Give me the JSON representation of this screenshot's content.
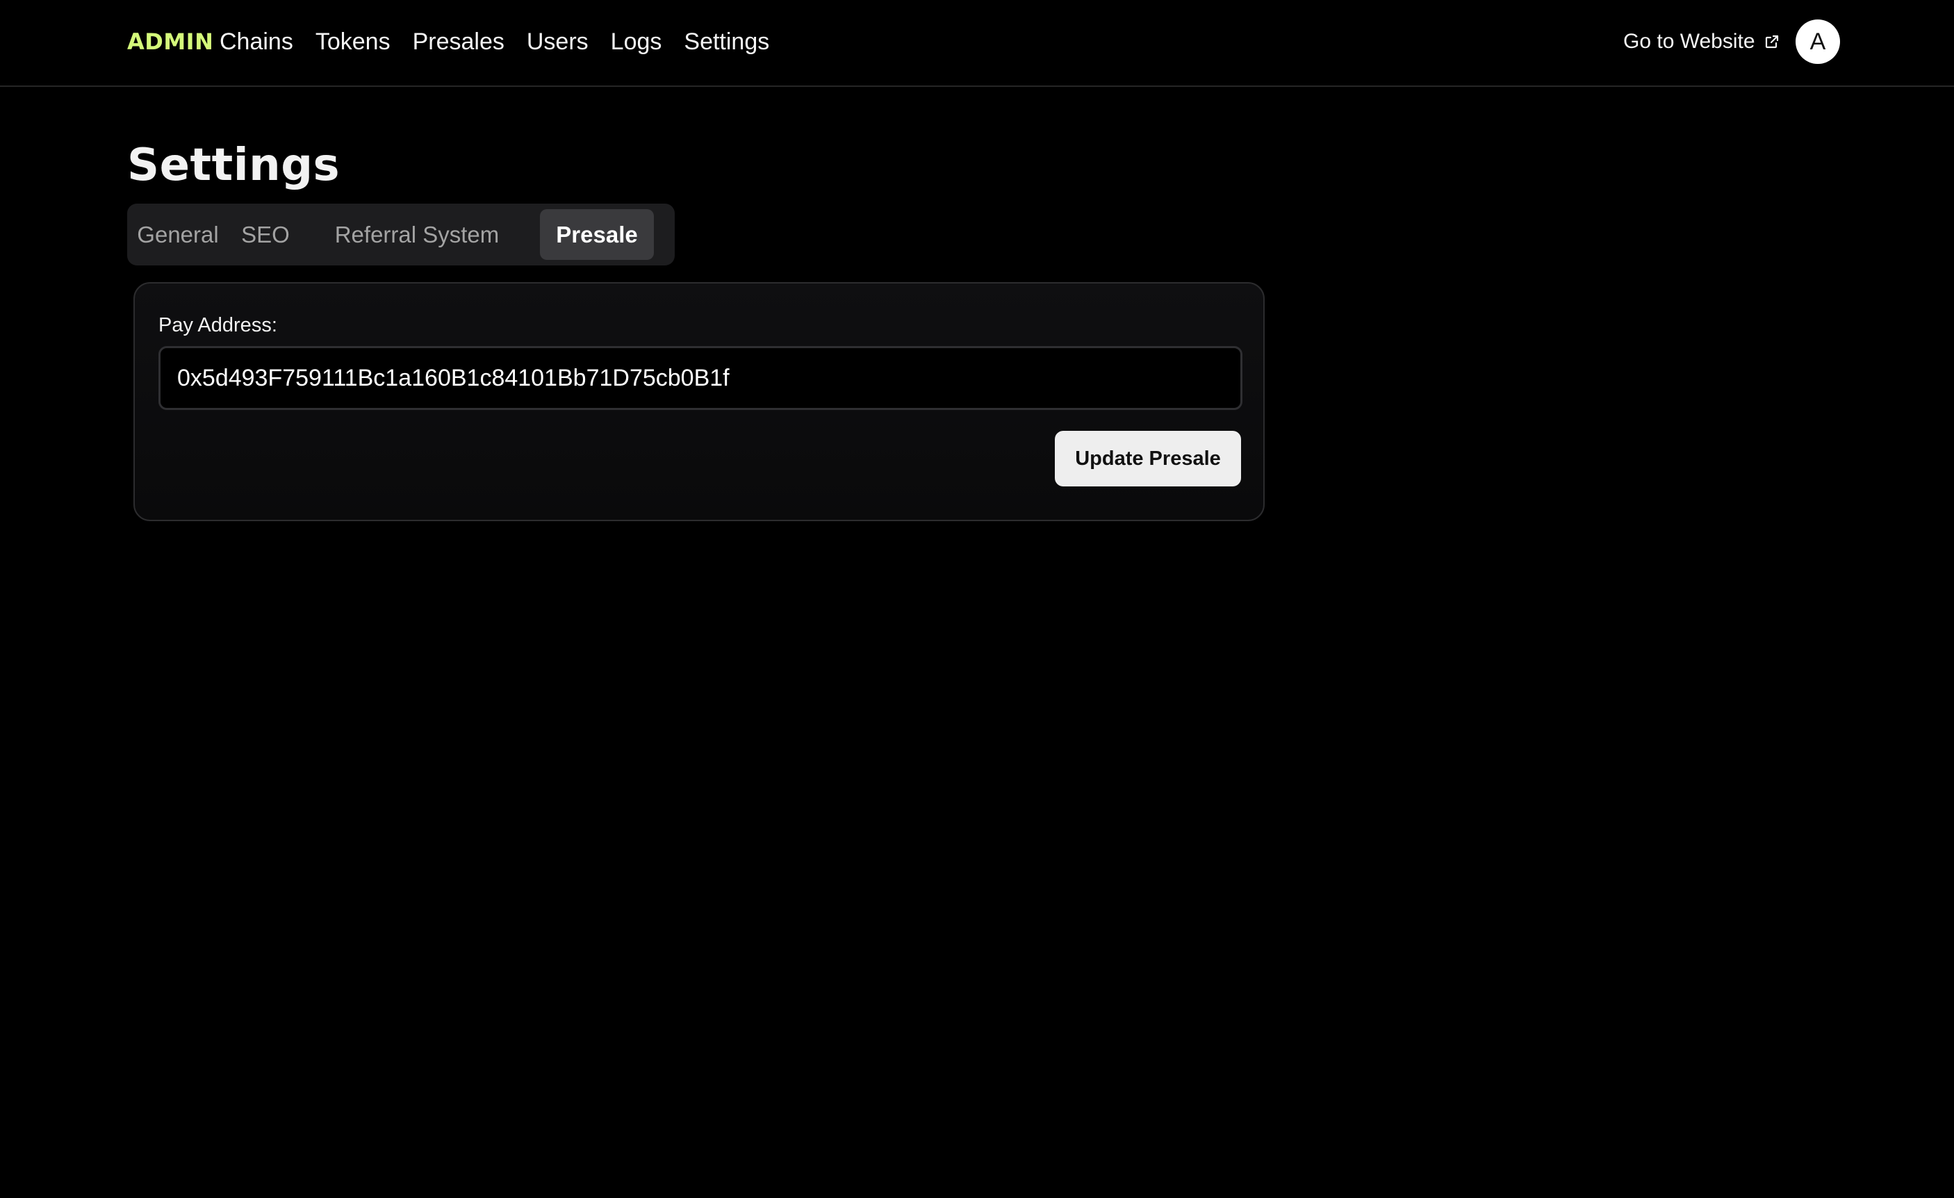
{
  "header": {
    "brand": "ADMIN",
    "brand_color": "#d4f97a",
    "nav": [
      "Chains",
      "Tokens",
      "Presales",
      "Users",
      "Logs",
      "Settings"
    ],
    "go_to_website": "Go to Website",
    "avatar_letter": "A"
  },
  "page": {
    "title": "Settings"
  },
  "tabs": {
    "items": [
      "General",
      "SEO",
      "Referral System",
      "Presale"
    ],
    "active": "Presale"
  },
  "presale_form": {
    "pay_address_label": "Pay Address:",
    "pay_address_value": "0x5d493F759111Bc1a160B1c84101Bb71D75cb0B1f",
    "submit_label": "Update Presale"
  },
  "icons": {
    "external_link": "external-link-icon"
  }
}
